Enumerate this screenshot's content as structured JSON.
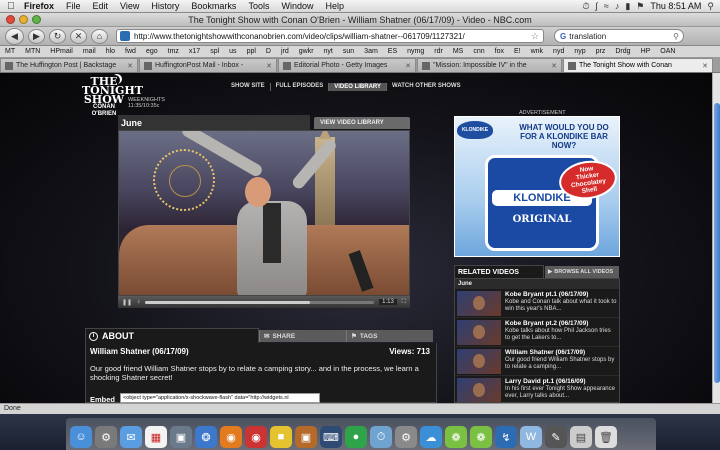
{
  "menubar": {
    "app": "Firefox",
    "items": [
      "File",
      "Edit",
      "View",
      "History",
      "Bookmarks",
      "Tools",
      "Window",
      "Help"
    ],
    "clock": "Thu 8:51 AM"
  },
  "window": {
    "title": "The Tonight Show with Conan O'Brien - William Shatner (06/17/09) - Video - NBC.com"
  },
  "toolbar": {
    "url": "http://www.thetonightshowwithconanobrien.com/video/clips/william-shatner--061709/1127321/",
    "search_value": "translation"
  },
  "bookmarks": [
    "MT",
    "MTN",
    "HPmail",
    "mail",
    "hlo",
    "fwd",
    "ego",
    "tmz",
    "x17",
    "spl",
    "us",
    "ppl",
    "D",
    "jrd",
    "gwkr",
    "nyt",
    "sun",
    "3am",
    "ES",
    "nymg",
    "rdr",
    "MS",
    "cnn",
    "fox",
    "E!",
    "wnk",
    "nyd",
    "nyp",
    "prz",
    "Drdg",
    "HP",
    "OAN"
  ],
  "tabs": [
    {
      "label": "The Huffington Post | Backstage",
      "active": false
    },
    {
      "label": "HuffingtonPost Mail - Inbox -",
      "active": false
    },
    {
      "label": "Editorial Photo - Getty Images",
      "active": false
    },
    {
      "label": "\"Mission: Impossible IV\" in the",
      "active": false
    },
    {
      "label": "The Tonight Show with Conan",
      "active": true
    }
  ],
  "site": {
    "logo_line1": "THE",
    "logo_line2": "TONIGHT",
    "logo_line3": "SHOW",
    "logo_line4": "CONAN O'BRIEN",
    "schedule_line1": "WEEKNIGHTS",
    "schedule_line2": "11:35/10:35c",
    "nav": [
      "SHOW SITE",
      "FULL EPISODES",
      "VIDEO LIBRARY",
      "WATCH OTHER SHOWS"
    ],
    "nav_active_index": 2
  },
  "video": {
    "month": "June",
    "view_library": "VIEW VIDEO LIBRARY",
    "progress_fraction": 0.72,
    "time": "1:13"
  },
  "about": {
    "tab_about": "ABOUT",
    "tab_share": "SHARE",
    "tab_tags": "TAGS",
    "title": "William Shatner (06/17/09)",
    "views": "Views: 713",
    "description": "Our good friend William Shatner stops by to relate a camping story... and in the process, we learn a shocking Shatner secret!",
    "embed_label": "Embed",
    "embed_code": "<object type=\"application/x-shockwave-flash\" data=\"http://widgets.nl"
  },
  "ad": {
    "label": "ADVERTISEMENT",
    "brand_small": "KLONDIKE",
    "headline_line1": "WHAT WOULD YOU DO",
    "headline_line2": "FOR A KLONDIKE BAR NOW?",
    "bar_name": "KLONDIKE",
    "bar_variety": "ORIGINAL",
    "burst_line1": "Now",
    "burst_line2": "Thicker",
    "burst_line3": "Chocolatey",
    "burst_line4": "Shell"
  },
  "related": {
    "title": "RELATED VIDEOS",
    "browse": "BROWSE ALL VIDEOS",
    "month": "June",
    "items": [
      {
        "title": "Kobe Bryant pt.1 (06/17/09)",
        "desc": "Kobe and Conan talk about what it took to win this year's NBA..."
      },
      {
        "title": "Kobe Bryant pt.2 (06/17/09)",
        "desc": "Kobe talks about how Phil Jackson tries to get the Lakers to..."
      },
      {
        "title": "William Shatner (06/17/09)",
        "desc": "Our good friend William Shatner stops by to relate a camping..."
      },
      {
        "title": "Larry David pt.1 (06/16/09)",
        "desc": "In his first ever Tonight Show appearance ever, Larry talks about..."
      }
    ]
  },
  "status": {
    "text": "Done"
  },
  "colors": {
    "ad_blue": "#1a4aa3",
    "page_bg": "#121218"
  }
}
